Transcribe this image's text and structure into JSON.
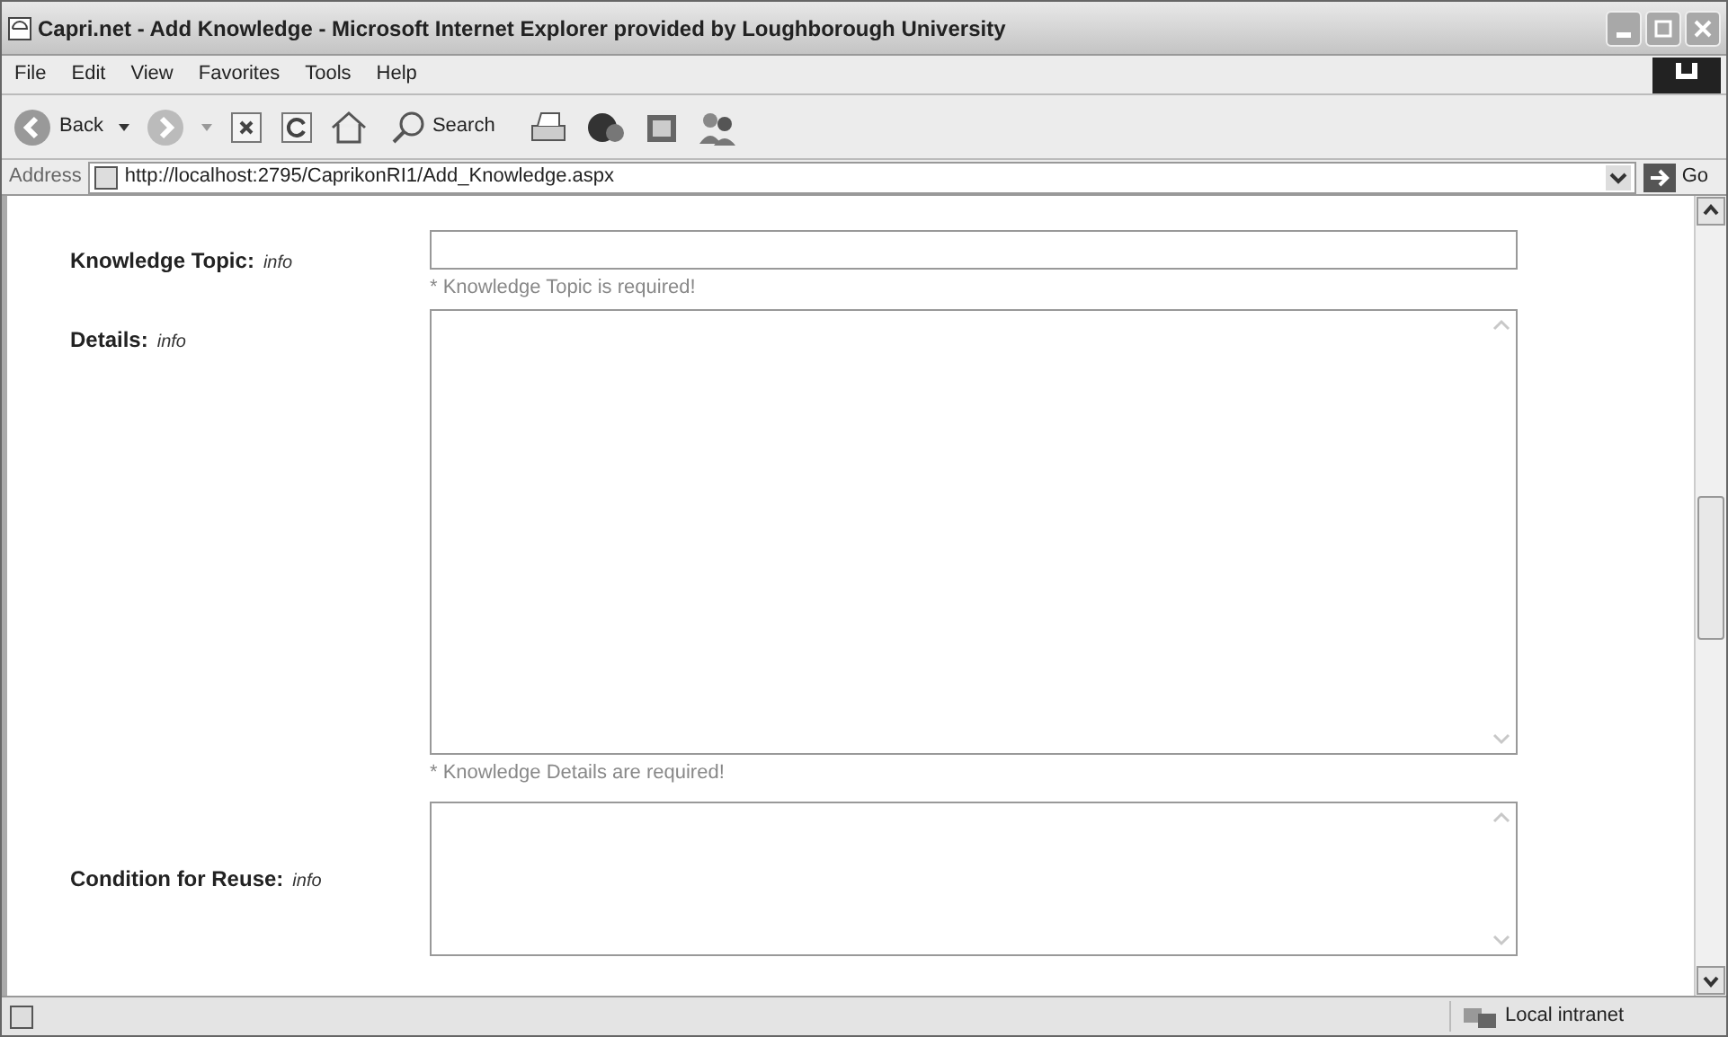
{
  "window": {
    "title": "Capri.net - Add Knowledge - Microsoft Internet Explorer provided by Loughborough University"
  },
  "menu": [
    "File",
    "Edit",
    "View",
    "Favorites",
    "Tools",
    "Help"
  ],
  "toolbar": {
    "back": "Back",
    "search": "Search"
  },
  "address": {
    "label": "Address",
    "url": "http://localhost:2795/CaprikonRI1/Add_Knowledge.aspx",
    "go": "Go"
  },
  "form": [
    {
      "kind": "input",
      "label": "Knowledge Topic:",
      "info": "info",
      "message": "* Knowledge Topic is required!"
    },
    {
      "kind": "textarea",
      "label": "Details:",
      "info": "info",
      "message": "* Knowledge Details are required!"
    },
    {
      "kind": "short-textarea",
      "label": "Condition for Reuse:",
      "info": "info"
    }
  ],
  "status_bar": {
    "zone": "Local intranet"
  }
}
